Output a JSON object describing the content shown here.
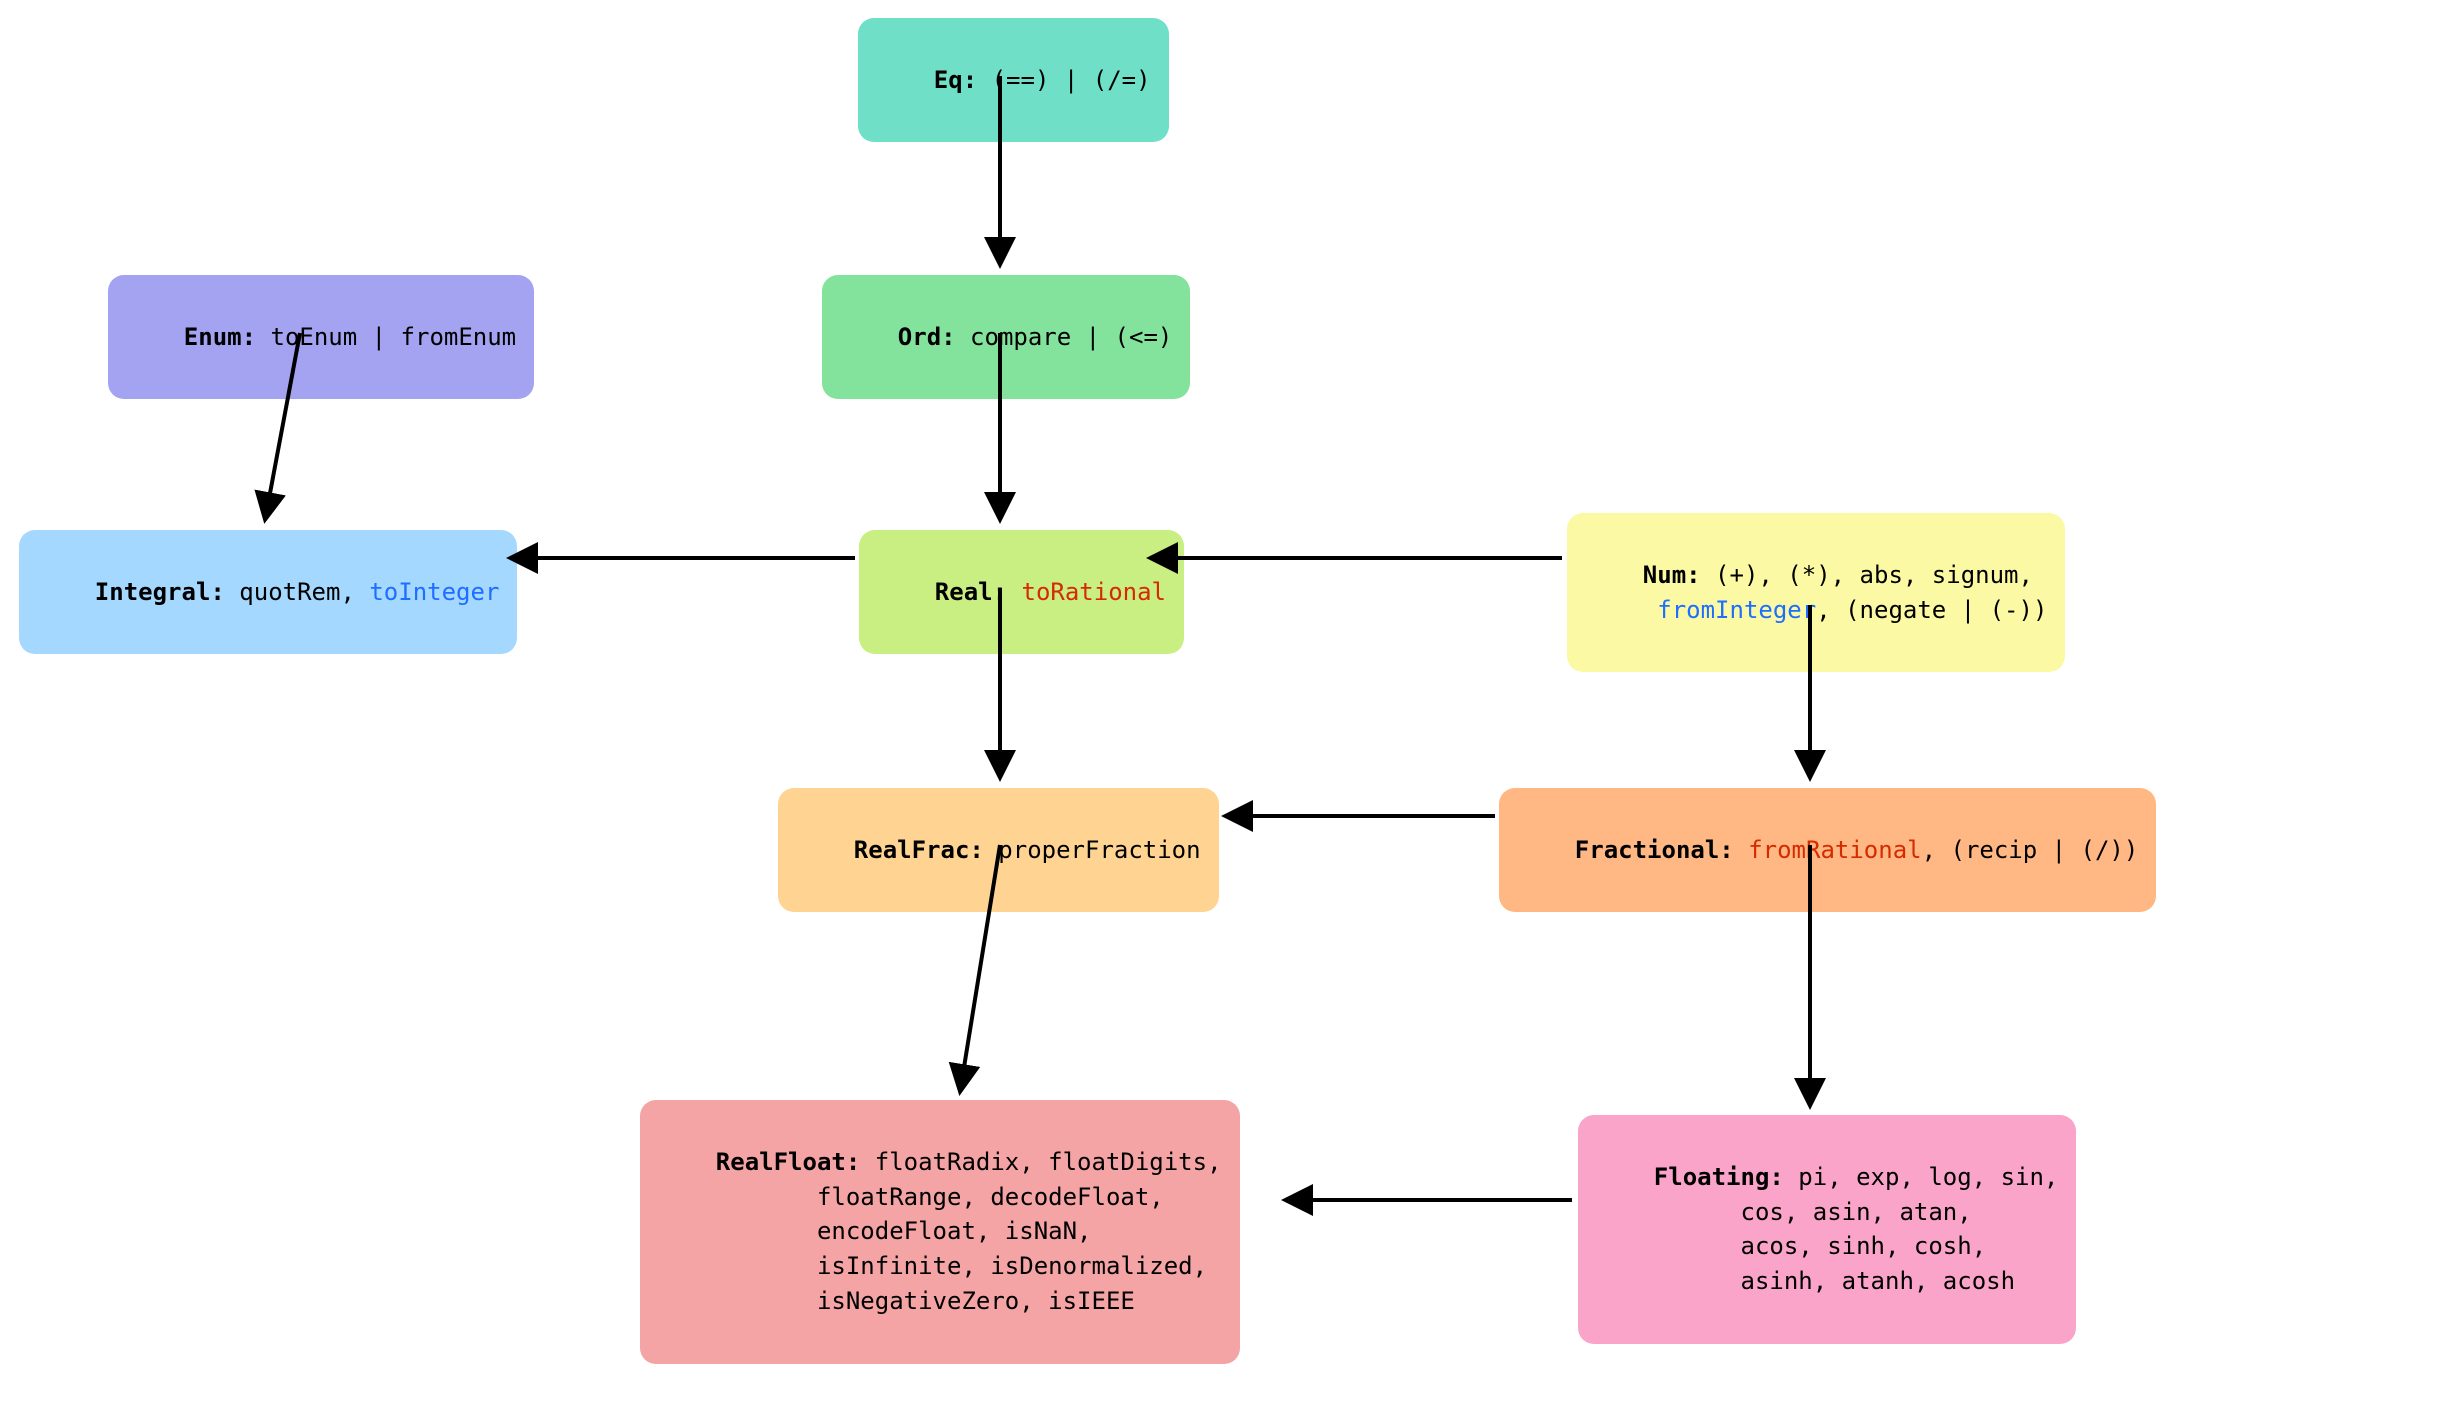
{
  "colors": {
    "eq": "#6fe0c7",
    "ord": "#83e39c",
    "enum": "#a4a3f2",
    "real": "#c9ef83",
    "integral": "#a5d8ff",
    "num": "#fbf9a4",
    "realfrac": "#ffd493",
    "fractional": "#ffb884",
    "realfloat": "#f4a4a4",
    "floating": "#f9a4c8"
  },
  "nodes": {
    "eq": {
      "cls": "Eq",
      "body": " (==) | (/=)"
    },
    "ord": {
      "cls": "Ord",
      "body": " compare | (<=)"
    },
    "enum": {
      "cls": "Enum",
      "body": " toEnum | fromEnum"
    },
    "real": {
      "cls": "Real",
      "body_pre": " ",
      "hl_red": "toRational",
      "body_post": ""
    },
    "integral": {
      "cls": "Integral",
      "body_pre": " quotRem, ",
      "hl_blue": "toInteger",
      "body_post": ""
    },
    "num": {
      "cls": "Num",
      "line1": " (+), (*), abs, signum,",
      "indent": "     ",
      "hl_blue": "fromInteger",
      "line2_post": ", (negate | (-))"
    },
    "realfrac": {
      "cls": "RealFrac",
      "body": " properFraction"
    },
    "fractional": {
      "cls": "Fractional",
      "body_pre": " ",
      "hl_red": "fromRational",
      "body_post": ", (recip | (/))"
    },
    "realfloat": {
      "cls": "RealFloat",
      "indent": "           ",
      "l1": " floatRadix, floatDigits,",
      "l2": "floatRange, decodeFloat,",
      "l3": "encodeFloat, isNaN,",
      "l4": "isInfinite, isDenormalized,",
      "l5": "isNegativeZero, isIEEE"
    },
    "floating": {
      "cls": "Floating",
      "indent": "          ",
      "l1": " pi, exp, log, sin,",
      "l2": "cos, asin, atan,",
      "l3": "acos, sinh, cosh,",
      "l4": "asinh, atanh, acosh"
    }
  },
  "edges": [
    {
      "from": "eq",
      "to": "ord"
    },
    {
      "from": "ord",
      "to": "real"
    },
    {
      "from": "enum",
      "to": "integral"
    },
    {
      "from": "real",
      "to": "integral"
    },
    {
      "from": "num",
      "to": "real"
    },
    {
      "from": "real",
      "to": "realfrac"
    },
    {
      "from": "num",
      "to": "fractional"
    },
    {
      "from": "fractional",
      "to": "realfrac"
    },
    {
      "from": "realfrac",
      "to": "realfloat"
    },
    {
      "from": "fractional",
      "to": "floating"
    },
    {
      "from": "floating",
      "to": "realfloat"
    }
  ]
}
